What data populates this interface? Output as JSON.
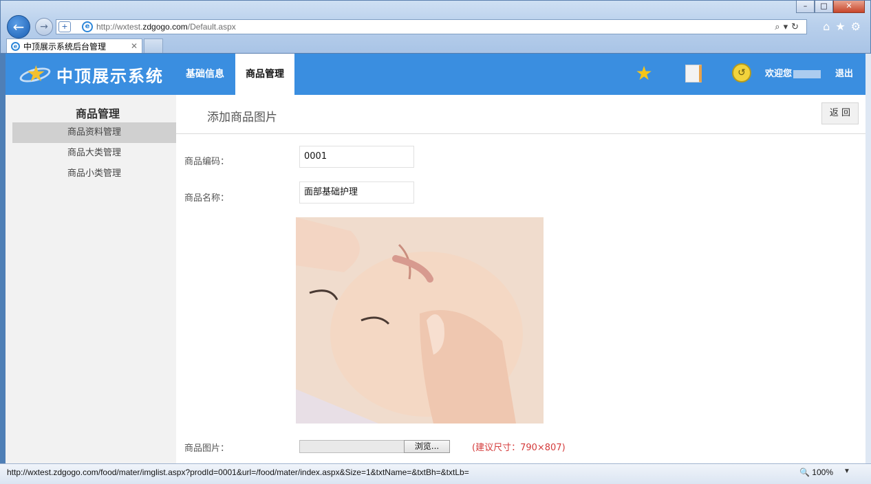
{
  "browser": {
    "url_prefix": "http://wxtest.",
    "url_domain": "zdgogo.com",
    "url_path": "/Default.aspx",
    "tab_title": "中顶展示系统后台管理",
    "status_url": "http://wxtest.zdgogo.com/food/mater/imglist.aspx?prodId=0001&url=/food/mater/index.aspx&Size=1&txtName=&txtBh=&txtLb=",
    "zoom": "100%"
  },
  "header": {
    "app_name": "中顶展示系统",
    "menu": [
      {
        "label": "基础信息"
      },
      {
        "label": "商品管理"
      }
    ],
    "welcome": "欢迎您",
    "logout": "退出"
  },
  "sidebar": {
    "title": "商品管理",
    "items": [
      {
        "label": "商品资料管理",
        "active": true
      },
      {
        "label": "商品大类管理",
        "active": false
      },
      {
        "label": "商品小类管理",
        "active": false
      }
    ]
  },
  "content": {
    "title": "添加商品图片",
    "back_label": "返 回",
    "fields": {
      "code_label": "商品编码：",
      "code_value": "0001",
      "name_label": "商品名称：",
      "name_value": "面部基础护理",
      "image_label": "商品图片：",
      "browse_label": "浏览...",
      "hint": "(建议尺寸：790×807)"
    }
  },
  "colors": {
    "topbar": "#3a8ee0",
    "sidebar": "#f2f2f2",
    "hint": "#d43a3a"
  }
}
